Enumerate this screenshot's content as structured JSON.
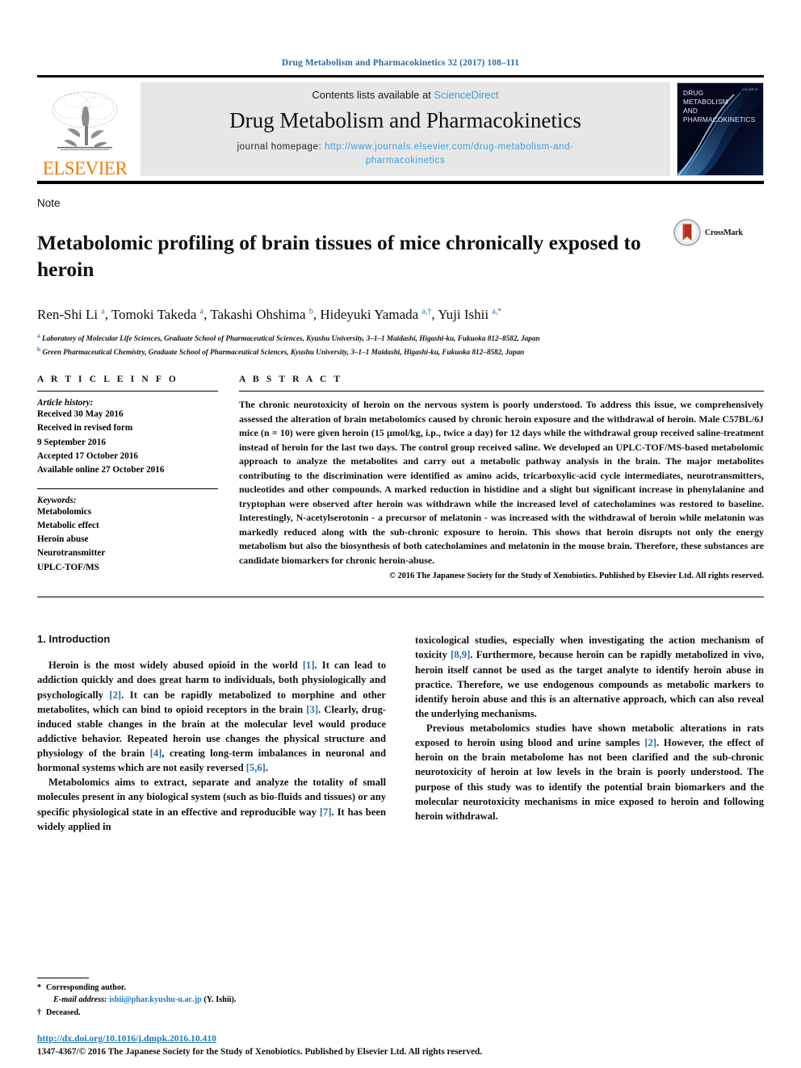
{
  "running_head": "Drug Metabolism and Pharmacokinetics 32 (2017) 108–111",
  "masthead": {
    "contents_prefix": "Contents lists available at ",
    "sciencedirect": "ScienceDirect",
    "journal_title": "Drug Metabolism and Pharmacokinetics",
    "homepage_label": "journal homepage: ",
    "homepage_url_line1": "http://www.journals.elsevier.com/drug-metabolism-and-",
    "homepage_url_line2": "pharmacokinetics",
    "publisher": "ELSEVIER",
    "cover_title_lines": [
      "DRUG",
      "METABOLISM",
      "AND",
      "PHARMACOKINETICS"
    ],
    "cover_volume": "VOLUME 32"
  },
  "article": {
    "type_label": "Note",
    "title": "Metabolomic profiling of brain tissues of mice chronically exposed to heroin",
    "crossmark_label": "CrossMark",
    "authors_html": "Ren-Shi Li <sup>a</sup>, Tomoki Takeda <sup>a</sup>, Takashi Ohshima <sup>b</sup>, Hideyuki Yamada <sup>a,†</sup>, Yuji Ishii <sup>a,*</sup>",
    "affiliations": [
      "Laboratory of Molecular Life Sciences, Graduate School of Pharmaceutical Sciences, Kyushu University, 3–1–1 Maidashi, Higashi-ku, Fukuoka 812–8582, Japan",
      "Green Pharmaceutical Chemistry, Graduate School of Pharmaceutical Sciences, Kyushu University, 3–1–1 Maidashi, Higashi-ku, Fukuoka 812–8582, Japan"
    ],
    "affiliation_marks": [
      "a",
      "b"
    ]
  },
  "article_info": {
    "heading": "A R T I C L E  I N F O",
    "history_label": "Article history:",
    "history": [
      "Received 30 May 2016",
      "Received in revised form",
      "9 September 2016",
      "Accepted 17 October 2016",
      "Available online 27 October 2016"
    ],
    "keywords_label": "Keywords:",
    "keywords": [
      "Metabolomics",
      "Metabolic effect",
      "Heroin abuse",
      "Neurotransmitter",
      "UPLC-TOF/MS"
    ]
  },
  "abstract": {
    "heading": "A B S T R A C T",
    "text": "The chronic neurotoxicity of heroin on the nervous system is poorly understood. To address this issue, we comprehensively assessed the alteration of brain metabolomics caused by chronic heroin exposure and the withdrawal of heroin. Male C57BL/6J mice (n = 10) were given heroin (15 μmol/kg, i.p., twice a day) for 12 days while the withdrawal group received saline-treatment instead of heroin for the last two days. The control group received saline. We developed an UPLC-TOF/MS-based metabolomic approach to analyze the metabolites and carry out a metabolic pathway analysis in the brain. The major metabolites contributing to the discrimination were identified as amino acids, tricarboxylic-acid cycle intermediates, neurotransmitters, nucleotides and other compounds. A marked reduction in histidine and a slight but significant increase in phenylalanine and tryptophan were observed after heroin was withdrawn while the increased level of catecholamines was restored to baseline. Interestingly, N-acetylserotonin - a precursor of melatonin - was increased with the withdrawal of heroin while melatonin was markedly reduced along with the sub-chronic exposure to heroin. This shows that heroin disrupts not only the energy metabolism but also the biosynthesis of both catecholamines and melatonin in the mouse brain. Therefore, these substances are candidate biomarkers for chronic heroin-abuse.",
    "copyright": "© 2016 The Japanese Society for the Study of Xenobiotics. Published by Elsevier Ltd. All rights reserved."
  },
  "introduction": {
    "section_title": "1. Introduction",
    "left_paragraphs_html": [
      "Heroin is the most widely abused opioid in the world <span class=\"ref\">[1]</span>. It can lead to addiction quickly and does great harm to individuals, both physiologically and psychologically <span class=\"ref\">[2]</span>. It can be rapidly metabolized to morphine and other metabolites, which can bind to opioid receptors in the brain <span class=\"ref\">[3]</span>. Clearly, drug-induced stable changes in the brain at the molecular level would produce addictive behavior. Repeated heroin use changes the physical structure and physiology of the brain <span class=\"ref\">[4]</span>, creating long-term imbalances in neuronal and hormonal systems which are not easily reversed <span class=\"ref\">[5,6]</span>.",
      "Metabolomics aims to extract, separate and analyze the totality of small molecules present in any biological system (such as bio-fluids and tissues) or any specific physiological state in an effective and reproducible way <span class=\"ref\">[7]</span>. It has been widely applied in"
    ],
    "right_paragraphs_html": [
      "toxicological studies, especially when investigating the action mechanism of toxicity <span class=\"ref\">[8,9]</span>. Furthermore, because heroin can be rapidly metabolized in vivo, heroin itself cannot be used as the target analyte to identify heroin abuse in practice. Therefore, we use endogenous compounds as metabolic markers to identify heroin abuse and this is an alternative approach, which can also reveal the underlying mechanisms.",
      "Previous metabolomics studies have shown metabolic alterations in rats exposed to heroin using blood and urine samples <span class=\"ref\">[2]</span>. However, the effect of heroin on the brain metabolome has not been clarified and the sub-chronic neurotoxicity of heroin at low levels in the brain is poorly understood. The purpose of this study was to identify the potential brain biomarkers and the molecular neurotoxicity mechanisms in mice exposed to heroin and following heroin withdrawal."
    ]
  },
  "footnotes": {
    "corresponding_mark": "*",
    "corresponding_text": "Corresponding author.",
    "email_label": "E-mail address:",
    "email": "ishii@phar.kyushu-u.ac.jp",
    "email_suffix": "(Y. Ishii).",
    "deceased_mark": "†",
    "deceased_text": "Deceased."
  },
  "footer": {
    "doi": "http://dx.doi.org/10.1016/j.dmpk.2016.10.410",
    "issn_line": "1347-4367/© 2016 The Japanese Society for the Study of Xenobiotics. Published by Elsevier Ltd. All rights reserved."
  },
  "colors": {
    "link_blue": "#2b6ca3",
    "sciencedirect_blue": "#3a9fd4",
    "elsevier_orange": "#F07C00",
    "band_gray": "#e7e7e7"
  }
}
